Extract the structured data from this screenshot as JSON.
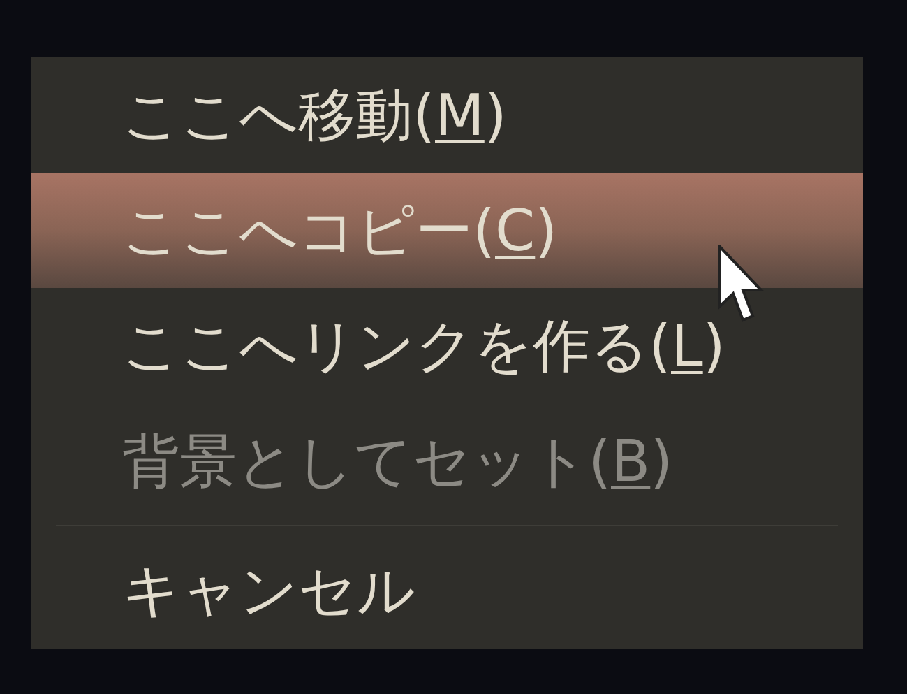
{
  "menu": {
    "items": [
      {
        "kind": "item",
        "before": "ここへ移動(",
        "mnemonic": "M",
        "after": ")",
        "selected": false,
        "disabled": false
      },
      {
        "kind": "item",
        "before": "ここへコピー(",
        "mnemonic": "C",
        "after": ")",
        "selected": true,
        "disabled": false
      },
      {
        "kind": "item",
        "before": "ここへリンクを作る(",
        "mnemonic": "L",
        "after": ")",
        "selected": false,
        "disabled": false
      },
      {
        "kind": "item",
        "before": "背景としてセット(",
        "mnemonic": "B",
        "after": ")",
        "selected": false,
        "disabled": true
      },
      {
        "kind": "separator"
      },
      {
        "kind": "item",
        "before": "キャンセル",
        "selected": false,
        "disabled": false
      }
    ]
  }
}
